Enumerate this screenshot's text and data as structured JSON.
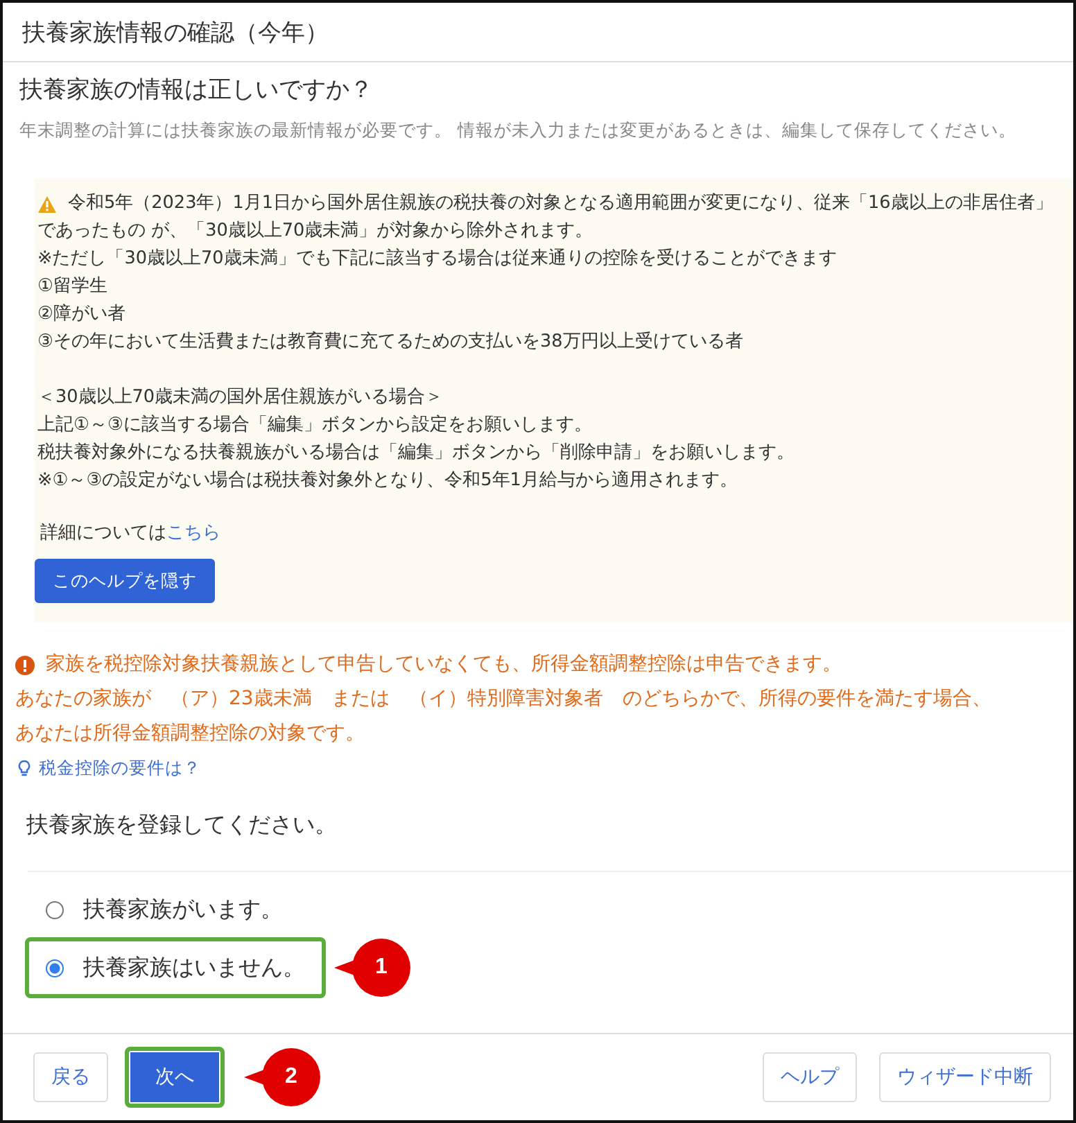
{
  "window": {
    "title": "扶養家族情報の確認（今年）"
  },
  "question": {
    "heading": "扶養家族の情報は正しいですか？",
    "description": "年末調整の計算には扶養家族の最新情報が必要です。 情報が未入力または変更があるときは、編集して保存してください。"
  },
  "help": {
    "blocks": [
      [
        "令和5年（2023年）1月1日から国外居住親族の税扶養の対象となる適用範囲が変更になり、従来「16歳以上の非居住者」",
        "であったもの が、「30歳以上70歳未満」が対象から除外されます。",
        "※ただし「30歳以上70歳未満」でも下記に該当する場合は従来通りの控除を受けることができます",
        "①留学生",
        "②障がい者",
        "③その年において生活費または教育費に充てるための支払いを38万円以上受けている者"
      ],
      [
        "＜30歳以上70歳未満の国外居住親族がいる場合＞",
        "上記①～③に該当する場合「編集」ボタンから設定をお願いします。",
        "税扶養対象外になる扶養親族がいる場合は「編集」ボタンから「削除申請」をお願いします。",
        "※①～③の設定がない場合は税扶養対象外となり、令和5年1月給与から適用されます。"
      ]
    ],
    "detail_text": "詳細については",
    "detail_link": "こちら",
    "hide_button": "このヘルプを隠す"
  },
  "notice": {
    "lines": [
      "家族を税控除対象扶養親族として申告していなくても、所得金額調整控除は申告できます。",
      "あなたの家族が　（ア）23歳未満　または　（イ）特別障害対象者　のどちらかで、所得の要件を満たす場合、",
      "あなたは所得金額調整控除の対象です。"
    ]
  },
  "tip_link": "税金控除の要件は？",
  "register": {
    "prompt": "扶養家族を登録してください。",
    "options": [
      {
        "label": "扶養家族がいます。",
        "selected": false,
        "highlighted": false
      },
      {
        "label": "扶養家族はいません。",
        "selected": true,
        "highlighted": true,
        "callout": "1"
      }
    ]
  },
  "footer": {
    "left_buttons": [
      {
        "label": "戻る",
        "kind": "secondary",
        "highlighted": false
      },
      {
        "label": "次へ",
        "kind": "primary",
        "highlighted": true,
        "callout": "2"
      }
    ],
    "right_buttons": [
      {
        "label": "ヘルプ",
        "kind": "secondary",
        "highlighted": false
      },
      {
        "label": "ウィザード中断",
        "kind": "secondary",
        "highlighted": false
      }
    ]
  }
}
